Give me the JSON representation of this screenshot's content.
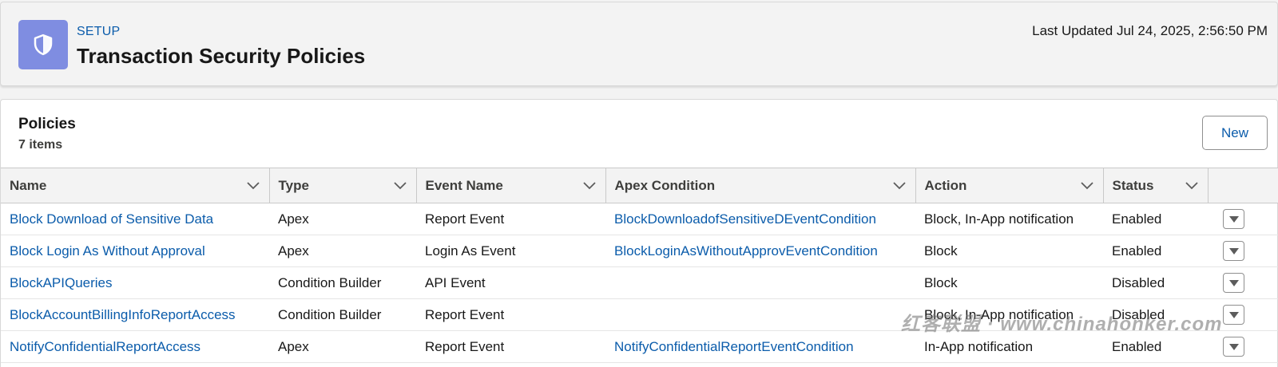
{
  "header": {
    "eyebrow": "SETUP",
    "title": "Transaction Security Policies",
    "last_updated": "Last Updated Jul 24, 2025, 2:56:50 PM",
    "icon": "shield-icon",
    "icon_bg": "#7f8de1"
  },
  "list": {
    "title": "Policies",
    "count": "7 items",
    "new_label": "New"
  },
  "table": {
    "columns": [
      "Name",
      "Type",
      "Event Name",
      "Apex Condition",
      "Action",
      "Status"
    ],
    "rows": [
      {
        "name": "Block Download of Sensitive Data",
        "type": "Apex",
        "event": "Report Event",
        "condition": "BlockDownloadofSensitiveDEventCondition",
        "action": "Block, In-App notification",
        "status": "Enabled"
      },
      {
        "name": "Block Login As Without Approval",
        "type": "Apex",
        "event": "Login As Event",
        "condition": "BlockLoginAsWithoutApprovEventCondition",
        "action": "Block",
        "status": "Enabled"
      },
      {
        "name": "BlockAPIQueries",
        "type": "Condition Builder",
        "event": "API Event",
        "condition": "",
        "action": "Block",
        "status": "Disabled"
      },
      {
        "name": "BlockAccountBillingInfoReportAccess",
        "type": "Condition Builder",
        "event": "Report Event",
        "condition": "",
        "action": "Block, In-App notification",
        "status": "Disabled"
      },
      {
        "name": "NotifyConfidentialReportAccess",
        "type": "Apex",
        "event": "Report Event",
        "condition": "NotifyConfidentialReportEventCondition",
        "action": "In-App notification",
        "status": "Enabled"
      }
    ]
  },
  "watermark": "红客联盟 · www.chinahonker.com",
  "colors": {
    "link": "#0b5cab",
    "header_bg": "#f3f3f3",
    "border": "#c9c9c9"
  }
}
